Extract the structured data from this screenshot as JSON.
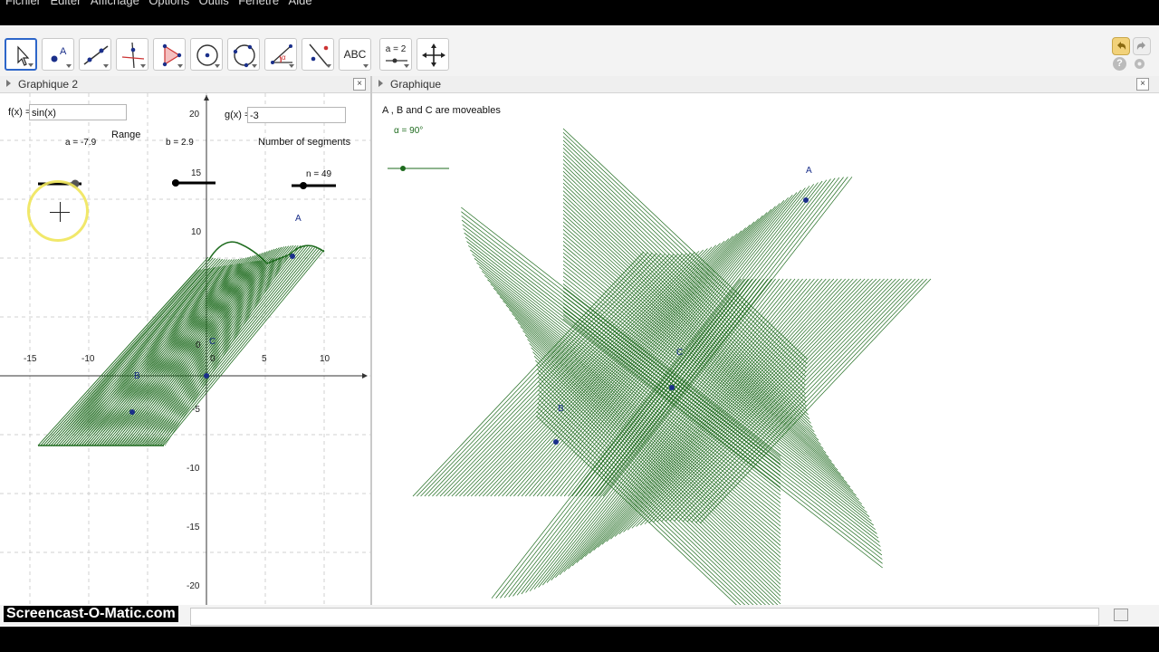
{
  "menu": [
    "Fichier",
    "Editer",
    "Affichage",
    "Options",
    "Outils",
    "Fenêtre",
    "Aide"
  ],
  "toolbar": {
    "tools": [
      {
        "name": "move-tool",
        "icon": "arrow-pointer-icon"
      },
      {
        "name": "point-tool",
        "icon": "point-icon"
      },
      {
        "name": "line-tool",
        "icon": "line-through-points-icon"
      },
      {
        "name": "perpendicular-tool",
        "icon": "perpendicular-line-icon"
      },
      {
        "name": "polygon-tool",
        "icon": "polygon-icon"
      },
      {
        "name": "circle-tool",
        "icon": "circle-center-point-icon"
      },
      {
        "name": "conic-tool",
        "icon": "circle-three-points-icon"
      },
      {
        "name": "angle-tool",
        "icon": "angle-icon"
      },
      {
        "name": "reflect-tool",
        "icon": "reflect-line-icon"
      },
      {
        "name": "text-tool",
        "icon": "text-icon",
        "label": "ABC"
      },
      {
        "name": "slider-tool",
        "icon": "slider-icon",
        "label": "a = 2"
      },
      {
        "name": "move-view-tool",
        "icon": "move-arrows-icon"
      }
    ]
  },
  "left_panel": {
    "title": "Graphique 2",
    "f_label": "f(x) =",
    "f_value": "sin(x)",
    "g_label": "g(x) =",
    "g_value": "-3",
    "range_label": "Range",
    "a_label": "a = -7.9",
    "b_label": "b = 2.9",
    "segments_label": "Number  of segments",
    "n_label": "n = 49",
    "point_A": "A",
    "point_B": "B",
    "point_C": "C",
    "x_ticks": [
      "-15",
      "-10",
      "0",
      "5",
      "10"
    ],
    "y_ticks": [
      "20",
      "15",
      "10",
      "0",
      "-5",
      "-10",
      "-15",
      "-20"
    ]
  },
  "right_panel": {
    "title": "Graphique",
    "caption": "A , B and C are moveables",
    "alpha_label": "α = 90°",
    "point_A": "A",
    "point_B": "B",
    "point_C": "C"
  },
  "watermark": "Screencast-O-Matic.com",
  "colors": {
    "curve_green": "#1e6b1e",
    "point_blue": "#1a2f8a",
    "selected_tool_border": "#2d66c9"
  }
}
